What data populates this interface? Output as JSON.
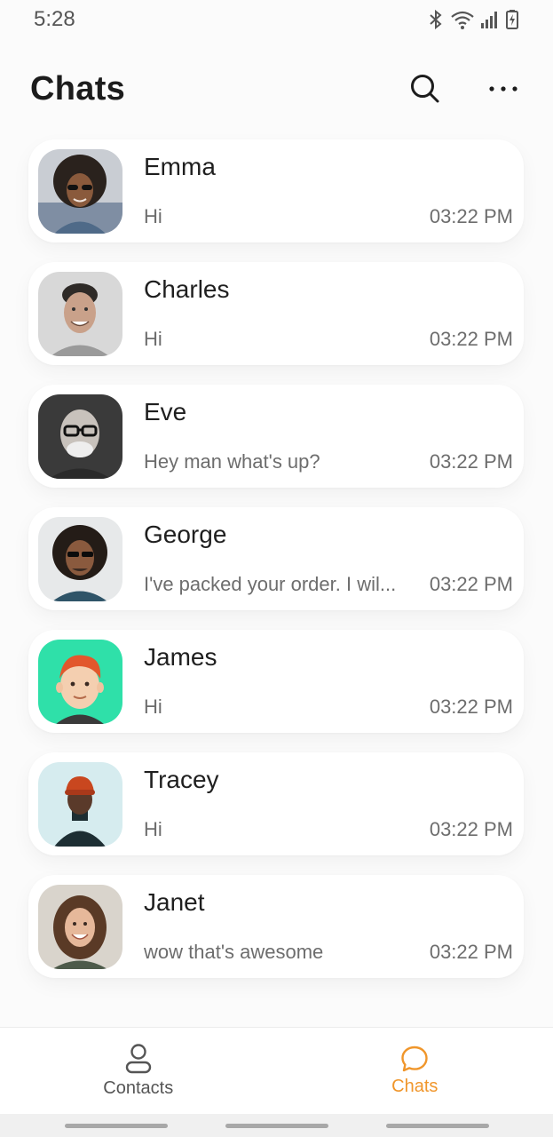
{
  "status_bar": {
    "time": "5:28"
  },
  "header": {
    "title": "Chats"
  },
  "chats": [
    {
      "name": "Emma",
      "message": "Hi",
      "time": "03:22 PM"
    },
    {
      "name": "Charles",
      "message": "Hi",
      "time": "03:22 PM"
    },
    {
      "name": "Eve",
      "message": "Hey man what's up?",
      "time": "03:22 PM"
    },
    {
      "name": "George",
      "message": "I've packed your order. I wil...",
      "time": "03:22 PM"
    },
    {
      "name": "James",
      "message": "Hi",
      "time": "03:22 PM"
    },
    {
      "name": "Tracey",
      "message": "Hi",
      "time": "03:22 PM"
    },
    {
      "name": "Janet",
      "message": "wow that's awesome",
      "time": "03:22 PM"
    }
  ],
  "bottom_nav": {
    "contacts_label": "Contacts",
    "chats_label": "Chats"
  },
  "colors": {
    "accent": "#f0962b",
    "background": "#fbfbfb"
  }
}
